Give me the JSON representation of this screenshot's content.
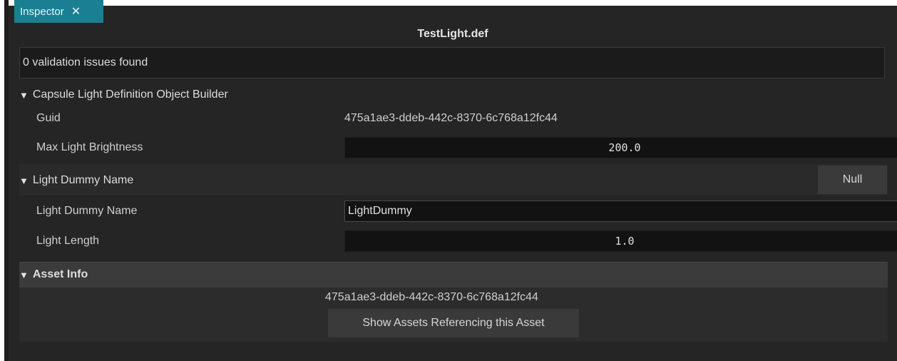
{
  "tab": {
    "label": "Inspector",
    "close_glyph": "✕",
    "color": "#1a7f93"
  },
  "title": "TestLight.def",
  "validation": {
    "text": "0 validation issues found"
  },
  "capsule_section": {
    "header": "Capsule Light Definition Object Builder",
    "guid_label": "Guid",
    "guid_value": "475a1ae3-ddeb-442c-8370-6c768a12fc44",
    "brightness_label": "Max Light Brightness",
    "brightness_value": "200.0"
  },
  "dummy_section": {
    "header": "Light Dummy Name",
    "null_button": "Null",
    "name_label": "Light Dummy Name",
    "name_value": "LightDummy",
    "length_label": "Light Length",
    "length_value": "1.0"
  },
  "asset_info": {
    "header": "Asset Info",
    "guid": "475a1ae3-ddeb-442c-8370-6c768a12fc44",
    "button": "Show Assets Referencing this Asset"
  },
  "icons": {
    "collapse": "triangle-down-icon",
    "close": "close-icon"
  }
}
